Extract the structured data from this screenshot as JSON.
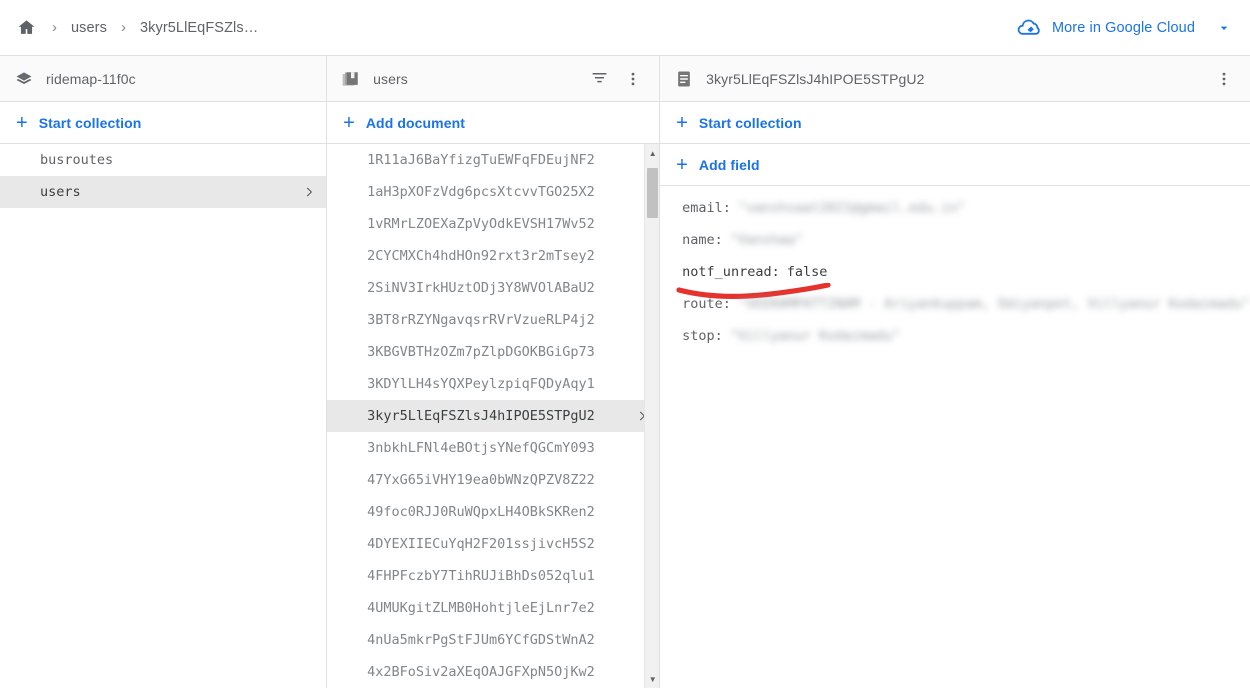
{
  "topbar": {
    "home_icon": "home-icon",
    "separator": "›",
    "breadcrumbs": [
      {
        "label": "users"
      },
      {
        "label": "3kyr5LlEqFSZls…"
      }
    ],
    "google_cloud": {
      "icon": "cloud-icon",
      "label": "More in Google Cloud",
      "chevron": "chevron-down-icon"
    }
  },
  "left_panel": {
    "icon": "database-stack-icon",
    "title": "ridemap-11f0c",
    "action": {
      "plus": "+",
      "label": "Start collection",
      "icon": "add-icon"
    },
    "collections": [
      {
        "label": "busroutes",
        "selected": false
      },
      {
        "label": "users",
        "selected": true,
        "chevron": "chevron-right-icon"
      }
    ]
  },
  "mid_panel": {
    "icon": "collection-icon",
    "title": "users",
    "filter_icon": "filter-icon",
    "menu_icon": "more-vert-icon",
    "action": {
      "plus": "+",
      "label": "Add document",
      "icon": "add-icon"
    },
    "documents": [
      {
        "id": "1R11aJ6BaYfizgTuEWFqFDEujNF2",
        "selected": false
      },
      {
        "id": "1aH3pXOFzVdg6pcsXtcvvTGO25X2",
        "selected": false
      },
      {
        "id": "1vRMrLZOEXaZpVyOdkEVSH17Wv52",
        "selected": false
      },
      {
        "id": "2CYCMXCh4hdHOn92rxt3r2mTsey2",
        "selected": false
      },
      {
        "id": "2SiNV3IrkHUztODj3Y8WVOlABaU2",
        "selected": false
      },
      {
        "id": "3BT8rRZYNgavqsrRVrVzueRLP4j2",
        "selected": false
      },
      {
        "id": "3KBGVBTHzOZm7pZlpDGOKBGiGp73",
        "selected": false
      },
      {
        "id": "3KDYlLH4sYQXPeylzpiqFQDyAqy1",
        "selected": false
      },
      {
        "id": "3kyr5LlEqFSZlsJ4hIPOE5STPgU2",
        "selected": true,
        "chevron": "chevron-right-icon"
      },
      {
        "id": "3nbkhLFNl4eBOtjsYNefQGCmY093",
        "selected": false
      },
      {
        "id": "47YxG65iVHY19ea0bWNzQPZV8Z22",
        "selected": false
      },
      {
        "id": "49foc0RJJ0RuWQpxLH4OBkSKRen2",
        "selected": false
      },
      {
        "id": "4DYEXIIECuYqH2F201ssjivcH5S2",
        "selected": false
      },
      {
        "id": "4FHPFczbY7TihRUJiBhDs052qlu1",
        "selected": false
      },
      {
        "id": "4UMUKgitZLMB0HohtjleEjLnr7e2",
        "selected": false
      },
      {
        "id": "4nUa5mkrPgStFJUm6YCfGDStWnA2",
        "selected": false
      },
      {
        "id": "4x2BFoSiv2aXEqOAJGFXpN5OjKw2",
        "selected": false
      }
    ],
    "scrollbar": {
      "up_arrow": "▲",
      "down_arrow": "▼"
    }
  },
  "right_panel": {
    "icon": "document-icon",
    "title": "3kyr5LlEqFSZlsJ4hIPOE5STPgU2",
    "menu_icon": "more-vert-icon",
    "action_collection": {
      "plus": "+",
      "label": "Start collection",
      "icon": "add-icon"
    },
    "action_field": {
      "plus": "+",
      "label": "Add field",
      "icon": "add-icon"
    },
    "fields": [
      {
        "key": "email:",
        "value": "\"vanshsaat2021@gmail.edu.in\"",
        "blurred": true,
        "highlighted": false
      },
      {
        "key": "name:",
        "value": "\"Vanshaa\"",
        "blurred": true,
        "highlighted": false
      },
      {
        "key": "notf_unread:",
        "value": "false",
        "blurred": false,
        "highlighted": true
      },
      {
        "key": "route:",
        "value": "\"VEERAMPATTINAM - Ariyankuppam, Odiyanpet, Villyanur Kodaimadu\"",
        "blurred": true,
        "highlighted": false
      },
      {
        "key": "stop:",
        "value": "\"Villyanur Kodaimadu\"",
        "blurred": true,
        "highlighted": false
      }
    ],
    "annotation": {
      "name": "red-underline-annotation",
      "color": "#e5322d"
    }
  },
  "colors": {
    "accent_blue": "#1a73e8",
    "text_grey": "#5f6368",
    "muted_grey": "#80868b",
    "selected_bg": "#e8e8e8",
    "border": "#e0e0e0",
    "annotation_red": "#e5322d"
  }
}
